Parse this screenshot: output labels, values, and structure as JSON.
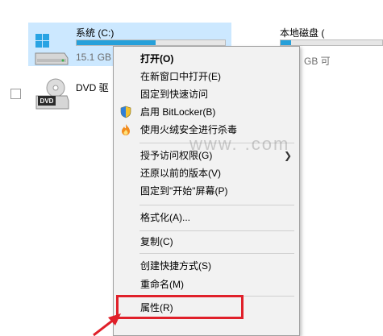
{
  "drives": {
    "c": {
      "name": "系统 (C:)",
      "size_text": "15.1 GB",
      "usage_fraction": 0.53
    },
    "local": {
      "name": "本地磁盘 (",
      "size_text": "GB 可",
      "usage_fraction": 0.1
    },
    "dvd": {
      "name": "DVD 驱",
      "icon_text": "DVD"
    }
  },
  "watermark": "www.   .com",
  "context_menu": {
    "items": [
      {
        "label": "打开(O)",
        "bold": true
      },
      {
        "label": "在新窗口中打开(E)"
      },
      {
        "label": "固定到快速访问"
      },
      {
        "label": "启用 BitLocker(B)",
        "icon": "shield-icon"
      },
      {
        "label": "使用火绒安全进行杀毒",
        "icon": "fire-icon"
      },
      {
        "label": "授予访问权限(G)",
        "submenu": true
      },
      {
        "label": "还原以前的版本(V)"
      },
      {
        "label": "固定到\"开始\"屏幕(P)"
      },
      {
        "label": "格式化(A)..."
      },
      {
        "label": "复制(C)"
      },
      {
        "label": "创建快捷方式(S)"
      },
      {
        "label": "重命名(M)"
      },
      {
        "label": "属性(R)",
        "highlighted": true
      }
    ]
  },
  "colors": {
    "selection": "#cce8ff",
    "bar_fill": "#26a0da",
    "highlight": "#e0202a"
  }
}
